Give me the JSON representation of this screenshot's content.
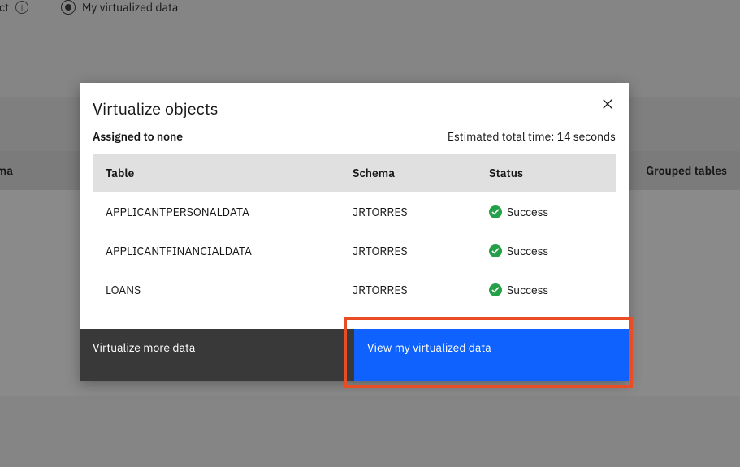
{
  "background": {
    "radio1_partial": "oject",
    "radio2": "My virtualized data",
    "header_left": "ema",
    "header_right": "Grouped tables"
  },
  "modal": {
    "title": "Virtualize objects",
    "assigned": "Assigned to none",
    "eta": "Estimated total time: 14 seconds",
    "columns": {
      "table": "Table",
      "schema": "Schema",
      "status": "Status"
    },
    "rows": [
      {
        "table": "APPLICANTPERSONALDATA",
        "schema": "JRTORRES",
        "status": "Success"
      },
      {
        "table": "APPLICANTFINANCIALDATA",
        "schema": "JRTORRES",
        "status": "Success"
      },
      {
        "table": "LOANS",
        "schema": "JRTORRES",
        "status": "Success"
      }
    ],
    "buttons": {
      "more": "Virtualize more data",
      "view": "View my virtualized data"
    }
  }
}
